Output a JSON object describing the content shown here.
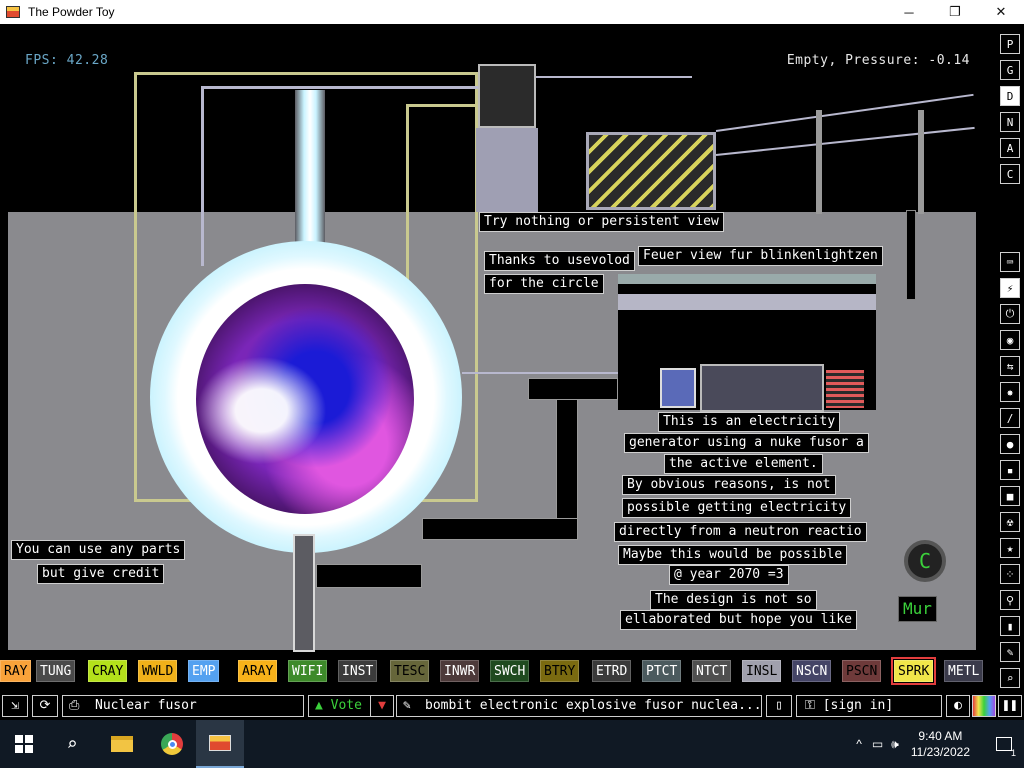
{
  "window": {
    "title": "The Powder Toy",
    "minimize": "─",
    "maximize": "❐",
    "close": "✕"
  },
  "hud": {
    "fps": "FPS: 42.28",
    "pressure": "Empty, Pressure: -0.14"
  },
  "signs": {
    "s1": "Try nothing or persistent view",
    "s2": "Thanks to usevolod",
    "s3": "for the circle",
    "s4": "Feuer view fur blinkenlightzen",
    "s5a": "This is an electricity",
    "s5b": "generator using a nuke fusor a",
    "s5c": "the active element.",
    "s6a": "By obvious reasons, is not",
    "s6b": "possible getting electricity",
    "s6c": "directly from a neutron reactio",
    "s7a": "Maybe this would be possible",
    "s7b": "@ year 2070 =3",
    "s8a": "The design is not so",
    "s8b": "ellaborated but hope you like",
    "s9a": "You can use any parts",
    "s9b": "but give credit",
    "s10": "Mur"
  },
  "c_badge": "C",
  "right_toolbar": {
    "top": [
      "P",
      "G",
      "D",
      "N",
      "A",
      "C"
    ],
    "icons": [
      "keyboard-icon",
      "plug-icon",
      "power-icon",
      "sensor-icon",
      "force-icon",
      "explosive-icon",
      "gas-icon",
      "liquid-icon",
      "powder-icon",
      "solid-icon",
      "radioactive-icon",
      "special-icon",
      "life-icon",
      "tools-icon",
      "favorite-icon",
      "decoration-icon",
      "search-icon"
    ]
  },
  "elements": [
    {
      "label": "RAY",
      "color": "#f9a23a",
      "text": "#000000"
    },
    {
      "label": "TUNG",
      "color": "#4a4a4a",
      "text": "#ffffff"
    },
    {
      "label": "CRAY",
      "color": "#b4e11b",
      "text": "#000000"
    },
    {
      "label": "WWLD",
      "color": "#f0b11a",
      "text": "#000000"
    },
    {
      "label": "EMP",
      "color": "#54a1f0",
      "text": "#ffffff"
    },
    {
      "label": "ARAY",
      "color": "#f8b21a",
      "text": "#000000"
    },
    {
      "label": "WIFI",
      "color": "#3d8a2a",
      "text": "#ffffff"
    },
    {
      "label": "INST",
      "color": "#3b3b3b",
      "text": "#ffffff"
    },
    {
      "label": "TESC",
      "color": "#66663a",
      "text": "#000000"
    },
    {
      "label": "INWR",
      "color": "#4d3a3a",
      "text": "#ffffff"
    },
    {
      "label": "SWCH",
      "color": "#1f4a1f",
      "text": "#ffffff"
    },
    {
      "label": "BTRY",
      "color": "#7a6a10",
      "text": "#000000"
    },
    {
      "label": "ETRD",
      "color": "#3a3a3a",
      "text": "#ffffff"
    },
    {
      "label": "PTCT",
      "color": "#4b5a5e",
      "text": "#ffffff"
    },
    {
      "label": "NTCT",
      "color": "#4f4f4f",
      "text": "#ffffff"
    },
    {
      "label": "INSL",
      "color": "#a0a0ad",
      "text": "#000000"
    },
    {
      "label": "NSCN",
      "color": "#444466",
      "text": "#ffffff"
    },
    {
      "label": "PSCN",
      "color": "#6e3a3a",
      "text": "#000000"
    },
    {
      "label": "SPRK",
      "color": "#f0e64a",
      "text": "#000000"
    },
    {
      "label": "METL",
      "color": "#3a3a4a",
      "text": "#ffffff"
    }
  ],
  "bottom_bar": {
    "save_name": "Nuclear fusor",
    "vote": "Vote",
    "description": "bombit electronic explosive fusor nuclea...",
    "sign_in": "[sign in]"
  },
  "taskbar": {
    "time": "9:40 AM",
    "date": "11/23/2022",
    "notification_count": "1"
  }
}
